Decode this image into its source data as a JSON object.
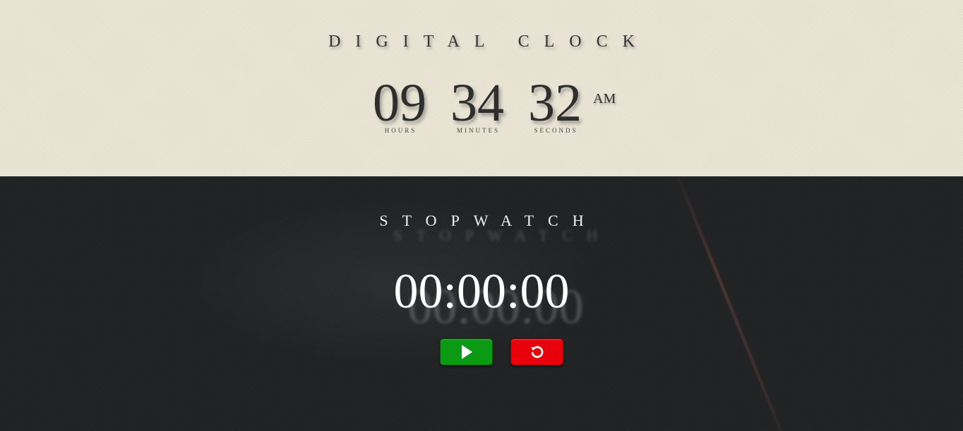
{
  "clock": {
    "title": "DIGITAL CLOCK",
    "hours": "09",
    "minutes": "34",
    "seconds": "32",
    "ampm": "AM",
    "labels": {
      "hours": "HOURS",
      "minutes": "MINUTES",
      "seconds": "SECONDS"
    }
  },
  "stopwatch": {
    "title": "STOPWATCH",
    "time": "00:00:00",
    "buttons": {
      "start": {
        "icon": "play-icon",
        "color": "#0a9a14"
      },
      "reset": {
        "icon": "reset-icon",
        "color": "#e8000b"
      }
    }
  },
  "colors": {
    "clock_bg": "#ebe6d6",
    "stopwatch_bg": "#222324"
  }
}
